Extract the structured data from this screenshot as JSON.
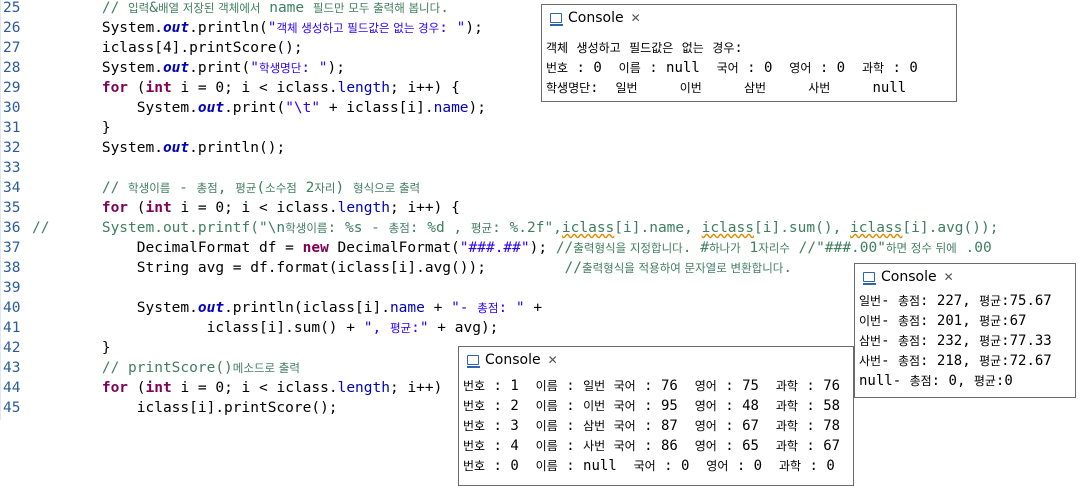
{
  "editor": {
    "lines": [
      {
        "n": "25",
        "tokens": [
          {
            "t": "        ",
            "c": ""
          },
          {
            "t": "// 입력&배열 저장된 객체에서 name 필드만 모두 출력해 봅니다.",
            "c": "cmt"
          }
        ]
      },
      {
        "n": "26",
        "tokens": [
          {
            "t": "        System.",
            "c": ""
          },
          {
            "t": "out",
            "c": "sf"
          },
          {
            "t": ".println(",
            "c": ""
          },
          {
            "t": "\"객체 생성하고 필드값은 없는 경우: \"",
            "c": "str"
          },
          {
            "t": ");",
            "c": ""
          }
        ]
      },
      {
        "n": "27",
        "tokens": [
          {
            "t": "        iclass[4].printScore();",
            "c": ""
          }
        ]
      },
      {
        "n": "28",
        "tokens": [
          {
            "t": "        System.",
            "c": ""
          },
          {
            "t": "out",
            "c": "sf"
          },
          {
            "t": ".print(",
            "c": ""
          },
          {
            "t": "\"학생명단: \"",
            "c": "str"
          },
          {
            "t": ");",
            "c": ""
          }
        ]
      },
      {
        "n": "29",
        "tokens": [
          {
            "t": "        ",
            "c": ""
          },
          {
            "t": "for",
            "c": "kw"
          },
          {
            "t": " (",
            "c": ""
          },
          {
            "t": "int",
            "c": "kw"
          },
          {
            "t": " i = 0; i < iclass.",
            "c": ""
          },
          {
            "t": "length",
            "c": "fld"
          },
          {
            "t": "; i++) {",
            "c": ""
          }
        ]
      },
      {
        "n": "30",
        "tokens": [
          {
            "t": "            System.",
            "c": ""
          },
          {
            "t": "out",
            "c": "sf"
          },
          {
            "t": ".print(",
            "c": ""
          },
          {
            "t": "\"\\t\"",
            "c": "str"
          },
          {
            "t": " + iclass[i].",
            "c": ""
          },
          {
            "t": "name",
            "c": "fld"
          },
          {
            "t": ");",
            "c": ""
          }
        ]
      },
      {
        "n": "31",
        "tokens": [
          {
            "t": "        }",
            "c": ""
          }
        ]
      },
      {
        "n": "32",
        "tokens": [
          {
            "t": "        System.",
            "c": ""
          },
          {
            "t": "out",
            "c": "sf"
          },
          {
            "t": ".println();",
            "c": ""
          }
        ]
      },
      {
        "n": "33",
        "tokens": []
      },
      {
        "n": "34",
        "tokens": [
          {
            "t": "        ",
            "c": ""
          },
          {
            "t": "// 학생이름 - 총점, 평균(소수점 2자리) 형식으로 출력",
            "c": "cmt"
          }
        ]
      },
      {
        "n": "35",
        "tokens": [
          {
            "t": "        ",
            "c": ""
          },
          {
            "t": "for",
            "c": "kw"
          },
          {
            "t": " (",
            "c": ""
          },
          {
            "t": "int",
            "c": "kw"
          },
          {
            "t": " i = 0; i < iclass.",
            "c": ""
          },
          {
            "t": "length",
            "c": "fld"
          },
          {
            "t": "; i++) {",
            "c": ""
          }
        ]
      },
      {
        "n": "36",
        "tokens": [
          {
            "t": "//      System.out.printf(\"\\n학생이름: %s - 총점: %d , 평균: %.2f\",",
            "c": "cmt"
          },
          {
            "t": "iclass",
            "c": "cmt err"
          },
          {
            "t": "[i].name, ",
            "c": "cmt"
          },
          {
            "t": "iclass",
            "c": "cmt err"
          },
          {
            "t": "[i].sum(), ",
            "c": "cmt"
          },
          {
            "t": "iclass",
            "c": "cmt err"
          },
          {
            "t": "[i].avg());",
            "c": "cmt"
          }
        ]
      },
      {
        "n": "37",
        "tokens": [
          {
            "t": "            DecimalFormat df = ",
            "c": ""
          },
          {
            "t": "new",
            "c": "kw"
          },
          {
            "t": " DecimalFormat(",
            "c": ""
          },
          {
            "t": "\"###.##\"",
            "c": "str"
          },
          {
            "t": "); ",
            "c": ""
          },
          {
            "t": "//출력형식을 지정합니다. #하나가 1자리수 //\"###.00\"하면 정수 뒤에 .00",
            "c": "cmt"
          }
        ]
      },
      {
        "n": "38",
        "tokens": [
          {
            "t": "            String avg = df.format(iclass[i].avg());         ",
            "c": ""
          },
          {
            "t": "//출력형식을 적용하여 문자열로 변환합니다.",
            "c": "cmt"
          }
        ]
      },
      {
        "n": "39",
        "tokens": []
      },
      {
        "n": "40",
        "tokens": [
          {
            "t": "            System.",
            "c": ""
          },
          {
            "t": "out",
            "c": "sf"
          },
          {
            "t": ".println(iclass[i].",
            "c": ""
          },
          {
            "t": "name",
            "c": "fld"
          },
          {
            "t": " + ",
            "c": ""
          },
          {
            "t": "\"- 총점: \"",
            "c": "str"
          },
          {
            "t": " +",
            "c": ""
          }
        ]
      },
      {
        "n": "41",
        "tokens": [
          {
            "t": "                    iclass[i].sum() + ",
            "c": ""
          },
          {
            "t": "\", 평균:\"",
            "c": "str"
          },
          {
            "t": " + avg);",
            "c": ""
          }
        ]
      },
      {
        "n": "42",
        "tokens": [
          {
            "t": "        }",
            "c": ""
          }
        ]
      },
      {
        "n": "43",
        "tokens": [
          {
            "t": "        ",
            "c": ""
          },
          {
            "t": "// printScore()메소드로 출력",
            "c": "cmt"
          }
        ]
      },
      {
        "n": "44",
        "tokens": [
          {
            "t": "        ",
            "c": ""
          },
          {
            "t": "for",
            "c": "kw"
          },
          {
            "t": " (",
            "c": ""
          },
          {
            "t": "int",
            "c": "kw"
          },
          {
            "t": " i = 0; i < iclass.",
            "c": ""
          },
          {
            "t": "length",
            "c": "fld"
          },
          {
            "t": "; i++)",
            "c": ""
          }
        ]
      },
      {
        "n": "45",
        "tokens": [
          {
            "t": "            iclass[i].printScore();",
            "c": ""
          }
        ]
      }
    ]
  },
  "consoles": {
    "top": {
      "title": "Console",
      "lines": [
        "객체 생성하고 필드값은 없는 경우:",
        "번호 : 0  이름 : null  국어 : 0  영어 : 0  과학 : 0",
        "학생명단:  일번     이번     삼번     사번     null"
      ]
    },
    "right": {
      "title": "Console",
      "lines": [
        "일번- 총점: 227, 평균:75.67",
        "이번- 총점: 201, 평균:67",
        "삼번- 총점: 232, 평균:77.33",
        "사번- 총점: 218, 평균:72.67",
        "null- 총점: 0, 평균:0"
      ]
    },
    "bottom": {
      "title": "Console",
      "lines": [
        "번호 : 1  이름 : 일번 국어 : 76  영어 : 75  과학 : 76",
        "번호 : 2  이름 : 이번 국어 : 95  영어 : 48  과학 : 58",
        "번호 : 3  이름 : 삼번 국어 : 87  영어 : 67  과학 : 78",
        "번호 : 4  이름 : 사번 국어 : 86  영어 : 65  과학 : 67",
        "번호 : 0  이름 : null  국어 : 0  영어 : 0  과학 : 0"
      ]
    }
  },
  "icons": {
    "console": "console-icon",
    "close": "close-icon"
  }
}
